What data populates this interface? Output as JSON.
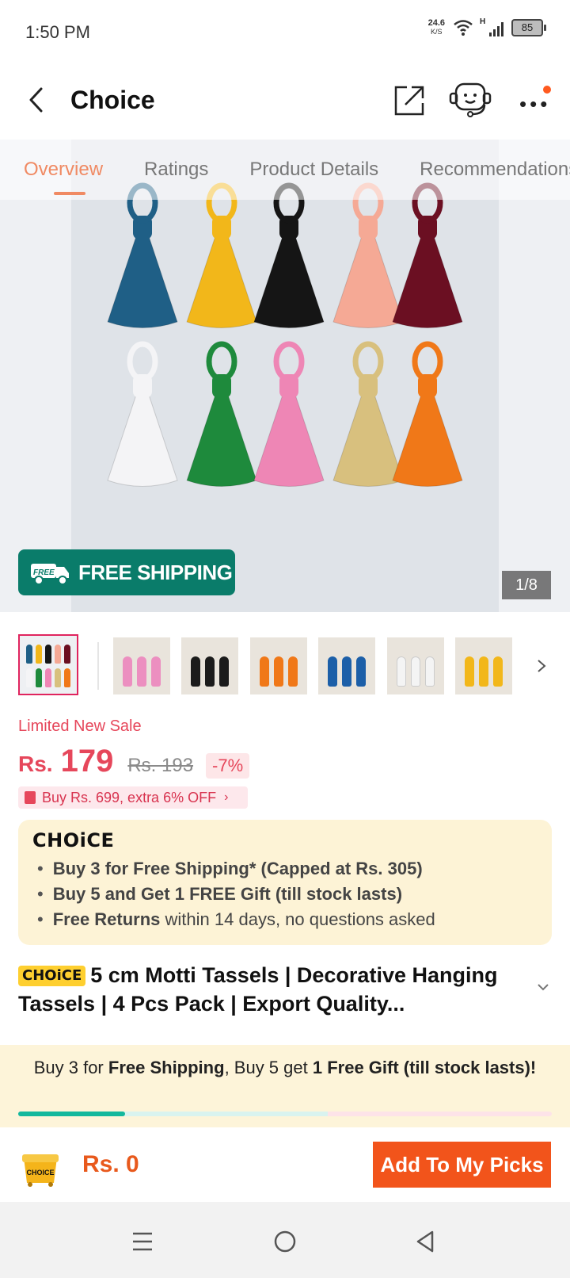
{
  "status_bar": {
    "time": "1:50 PM",
    "net_speed": "24.6",
    "net_unit": "K/S",
    "signal_type": "H",
    "battery": "85"
  },
  "header": {
    "title": "Choice",
    "icons": [
      "back-arrow-icon",
      "share-icon",
      "customer-support-icon",
      "more-options-icon"
    ],
    "notification_dot_color": "#ff5a1f"
  },
  "tabs": [
    {
      "label": "Overview",
      "active": true
    },
    {
      "label": "Ratings",
      "active": false
    },
    {
      "label": "Product Details",
      "active": false
    },
    {
      "label": "Recommendations",
      "active": false
    }
  ],
  "gallery": {
    "free_shipping": "FREE SHIPPING",
    "free_badge": "FREE",
    "counter": "1/8",
    "tassel_colors": [
      "#1f5f86",
      "#f2b71a",
      "#151515",
      "#f5a995",
      "#6b0f22",
      "#f4f4f6",
      "#1e8a3c",
      "#ee86b5",
      "#d8c07e",
      "#f07818"
    ],
    "thumbnail_colors": [
      "multicolor",
      "#ec8fc0",
      "#1b1b1b",
      "#f07818",
      "#1c5fa8",
      "#f4f4f4",
      "#f2b71a"
    ]
  },
  "price": {
    "sale_label": "Limited New Sale",
    "currency": "Rs.",
    "current": "179",
    "original": "Rs. 193",
    "discount": "-7%",
    "coupon": "Buy Rs. 699, extra 6% OFF",
    "accent": "#e6475b"
  },
  "choice_box": {
    "logo": "CHOiCE",
    "items": [
      {
        "bold": "Buy 3 for  Free Shipping* (Capped at Rs. 305)",
        "rest": ""
      },
      {
        "bold": "Buy 5 and Get 1 FREE Gift (till stock lasts)",
        "rest": ""
      },
      {
        "bold": "Free Returns",
        "rest": " within 14 days, no questions asked"
      }
    ]
  },
  "product": {
    "badge": "CHOiCE",
    "title": "5 cm Motti Tassels | Decorative Hanging Tassels | 4 Pcs Pack | Export Quality..."
  },
  "promo": {
    "part1": "Buy 3 for ",
    "bold1": "Free Shipping",
    "part2": ", Buy 5 get ",
    "bold2": "1 Free Gift (till stock lasts)!",
    "progress": 0.2,
    "progress_color": "#13b89d"
  },
  "action_bar": {
    "cart_label": "CHOICE",
    "total": "Rs. 0",
    "button": "Add To My Picks",
    "button_color": "#f2541b"
  },
  "nav_bar": {
    "icons": [
      "recent-apps-icon",
      "home-icon",
      "back-icon"
    ]
  }
}
